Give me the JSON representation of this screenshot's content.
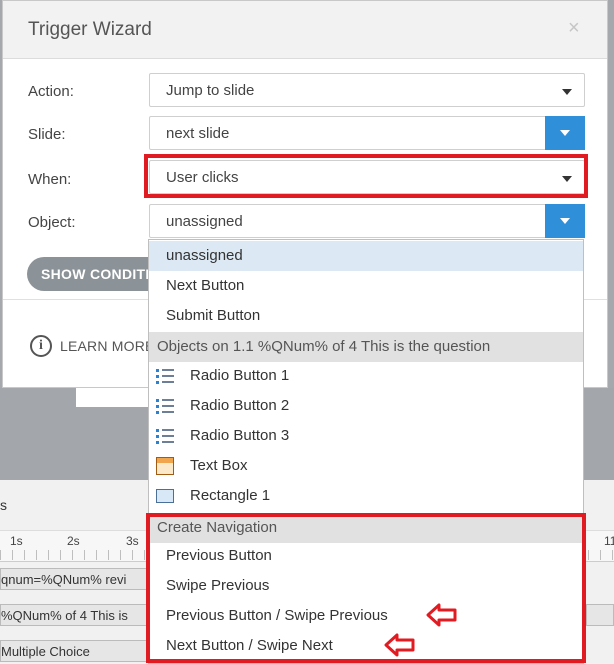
{
  "dialog": {
    "title": "Trigger Wizard",
    "close_glyph": "×",
    "fields": {
      "action": {
        "label": "Action:",
        "value": "Jump to slide"
      },
      "slide": {
        "label": "Slide:",
        "value": "next slide"
      },
      "when": {
        "label": "When:",
        "value": "User clicks"
      },
      "object": {
        "label": "Object:",
        "value": "unassigned"
      }
    },
    "show_conditions_label": "SHOW CONDITIONS",
    "learn_more_label": "LEARN MORE",
    "info_glyph": "i"
  },
  "dropdown": {
    "items_top": [
      "unassigned",
      "Next Button",
      "Submit Button"
    ],
    "group_objects": "Objects on 1.1 %QNum% of 4 This is the question",
    "objects": [
      {
        "label": "Radio Button 1",
        "icon": "radio-list-icon"
      },
      {
        "label": "Radio Button 2",
        "icon": "radio-list-icon"
      },
      {
        "label": "Radio Button 3",
        "icon": "radio-list-icon"
      },
      {
        "label": "Text Box",
        "icon": "text-box-icon"
      },
      {
        "label": "Rectangle 1",
        "icon": "rectangle-icon"
      }
    ],
    "group_create": "Create Navigation",
    "create_items": [
      "Previous Button",
      "Swipe Previous",
      "Previous Button / Swipe Previous",
      "Next Button / Swipe Next"
    ]
  },
  "timeline": {
    "header_label": "s",
    "ticks": [
      "1s",
      "2s",
      "3s"
    ],
    "right_tick": "11",
    "rows": [
      "qnum=%QNum% revi",
      "%QNum% of 4  This is",
      "Multiple Choice"
    ]
  },
  "colors": {
    "highlight_red": "#e01b22",
    "select_blue": "#2f8fd8",
    "selected_row": "#dce8f4"
  }
}
